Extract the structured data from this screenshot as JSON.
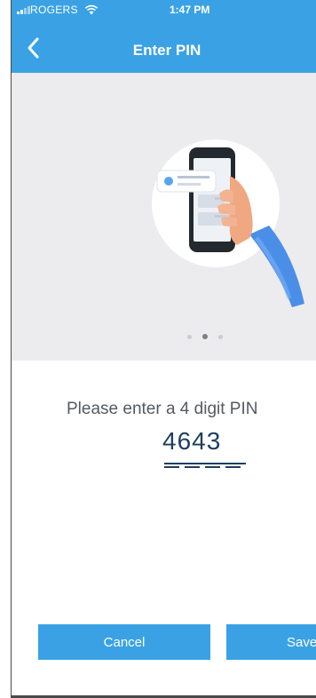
{
  "status_bar": {
    "carrier": "ROGERS",
    "time": "1:47 PM"
  },
  "nav": {
    "title": "Enter PIN",
    "back_icon": "chevron-left-icon"
  },
  "carousel": {
    "page_count": 3,
    "active_page": 2
  },
  "form": {
    "prompt": "Please enter a 4 digit PIN",
    "pin_value": "4643"
  },
  "actions": {
    "cancel_label": "Cancel",
    "save_label": "Save"
  },
  "colors": {
    "accent": "#3aa2e4",
    "hero_bg": "#ececef",
    "pin_text": "#1e3f61",
    "prompt_text": "#555a60"
  }
}
